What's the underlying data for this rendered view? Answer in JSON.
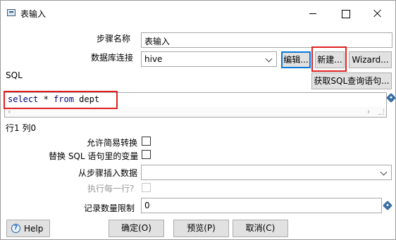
{
  "window": {
    "title": "表输入"
  },
  "form": {
    "step_name_label": "步骤名称",
    "step_name_value": "表输入",
    "db_connection_label": "数据库连接",
    "db_connection_value": "hive",
    "edit_button": "编辑...",
    "new_button": "新建...",
    "wizard_button": "Wizard...",
    "sql_label": "SQL",
    "get_sql_button": "获取SQL查询语句...",
    "sql_keyword_select": "select",
    "sql_rest_1": " * ",
    "sql_keyword_from": "from",
    "sql_rest_2": " dept",
    "cursor_position": "行1 列0",
    "lazy_conversion_label": "允许简易转换",
    "replace_vars_label": "替换 SQL 语句里的变量",
    "insert_from_step_label": "从步骤插入数据",
    "insert_from_step_value": "",
    "execute_each_row_label": "执行每一行?",
    "limit_label": "记录数量限制",
    "limit_value": "0"
  },
  "checkboxes": {
    "lazy_conversion": false,
    "replace_vars": false,
    "execute_each_row": false
  },
  "footer": {
    "help_button": "Help",
    "ok_button": "确定(O)",
    "preview_button": "预览(P)",
    "cancel_button": "取消(C)"
  },
  "colors": {
    "highlight_box": "#e02020",
    "sql_keyword": "#00007a",
    "focus_border": "#0a78d7"
  }
}
